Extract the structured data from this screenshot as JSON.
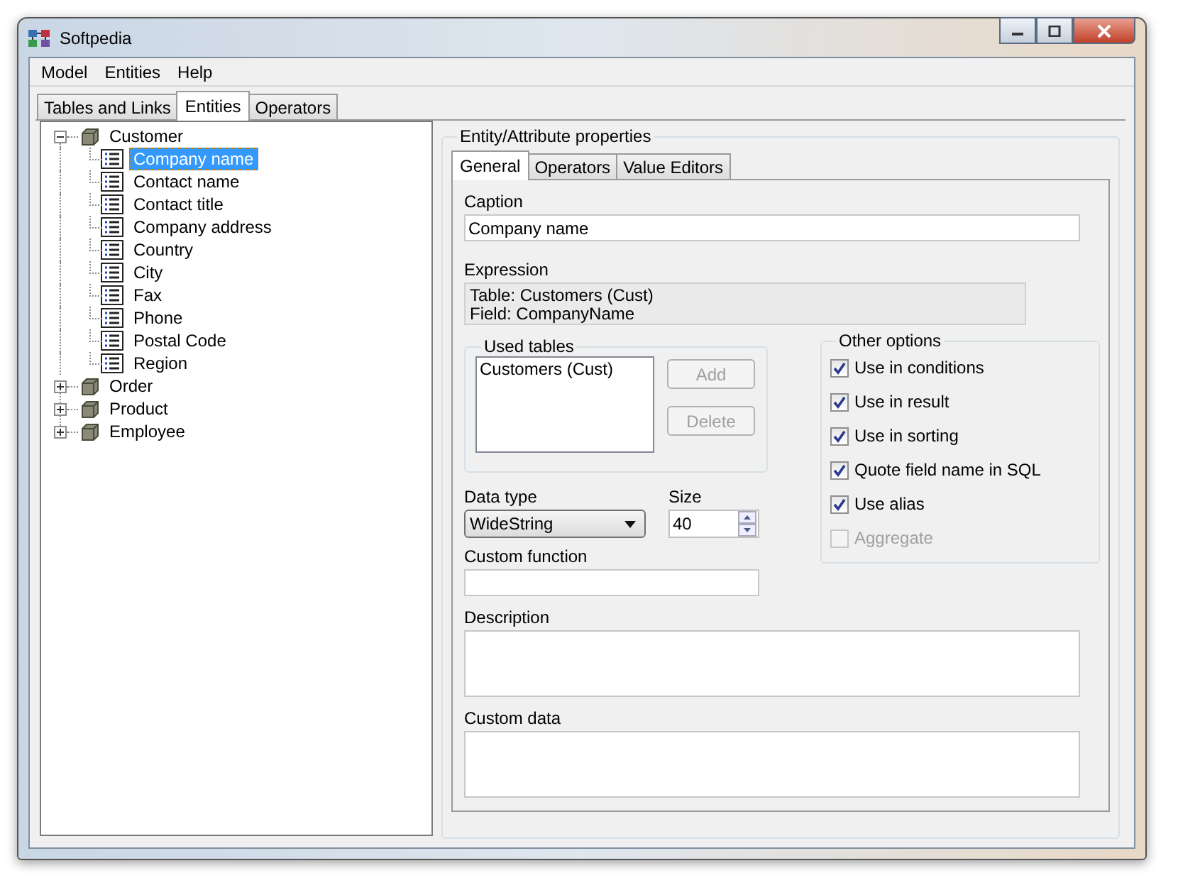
{
  "window": {
    "title": "Softpedia"
  },
  "menu": [
    "Model",
    "Entities",
    "Help"
  ],
  "tabs": [
    {
      "label": "Tables and Links",
      "selected": false
    },
    {
      "label": "Entities",
      "selected": true
    },
    {
      "label": "Operators",
      "selected": false
    }
  ],
  "tree": [
    {
      "label": "Customer",
      "expanded": true,
      "selected": false,
      "children": [
        {
          "label": "Company name",
          "selected": true
        },
        {
          "label": "Contact name",
          "selected": false
        },
        {
          "label": "Contact title",
          "selected": false
        },
        {
          "label": "Company address",
          "selected": false
        },
        {
          "label": "Country",
          "selected": false
        },
        {
          "label": "City",
          "selected": false
        },
        {
          "label": "Fax",
          "selected": false
        },
        {
          "label": "Phone",
          "selected": false
        },
        {
          "label": "Postal Code",
          "selected": false
        },
        {
          "label": "Region",
          "selected": false
        }
      ]
    },
    {
      "label": "Order",
      "expanded": false,
      "selected": false
    },
    {
      "label": "Product",
      "expanded": false,
      "selected": false
    },
    {
      "label": "Employee",
      "expanded": false,
      "selected": false
    }
  ],
  "properties": {
    "title": "Entity/Attribute properties",
    "tabs": [
      {
        "label": "General",
        "selected": true
      },
      {
        "label": "Operators",
        "selected": false
      },
      {
        "label": "Value Editors",
        "selected": false
      }
    ],
    "caption": {
      "label": "Caption",
      "value": "Company name"
    },
    "expression": {
      "label": "Expression",
      "lines": [
        "Table: Customers (Cust)",
        "Field: CompanyName"
      ]
    },
    "used_tables": {
      "label": "Used tables",
      "items": [
        "Customers (Cust)"
      ],
      "buttons": [
        {
          "label": "Add",
          "disabled": true
        },
        {
          "label": "Delete",
          "disabled": true
        }
      ]
    },
    "data_type": {
      "label": "Data type",
      "value": "WideString"
    },
    "size": {
      "label": "Size",
      "value": "40"
    },
    "custom_function": {
      "label": "Custom function"
    },
    "other_options": {
      "label": "Other options",
      "options": [
        {
          "label": "Use in conditions",
          "checked": true,
          "disabled": false
        },
        {
          "label": "Use in result",
          "checked": true,
          "disabled": false
        },
        {
          "label": "Use in sorting",
          "checked": true,
          "disabled": false
        },
        {
          "label": "Quote field name in SQL",
          "checked": true,
          "disabled": false
        },
        {
          "label": "Use alias",
          "checked": true,
          "disabled": false
        },
        {
          "label": "Aggregate",
          "checked": false,
          "disabled": true
        }
      ]
    },
    "description": {
      "label": "Description"
    },
    "custom_data": {
      "label": "Custom data"
    }
  }
}
